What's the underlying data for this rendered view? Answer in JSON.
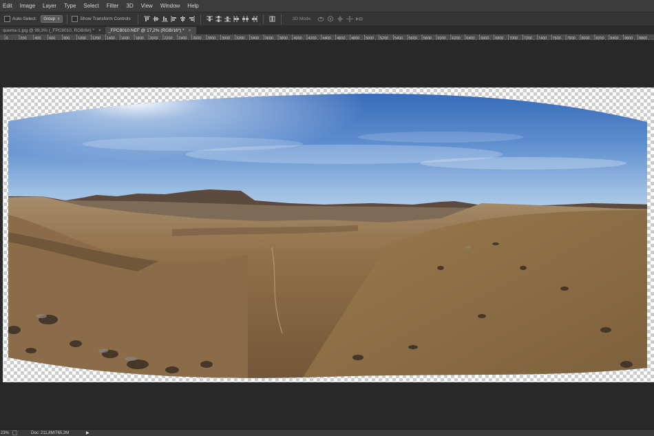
{
  "menu": [
    "Edit",
    "Image",
    "Layer",
    "Type",
    "Select",
    "Filter",
    "3D",
    "View",
    "Window",
    "Help"
  ],
  "options": {
    "auto_select_label": "Auto-Select:",
    "auto_select_value": "Group",
    "show_transform_label": "Show Transform Controls",
    "mode_3d_label": "3D Mode:"
  },
  "tabs": [
    {
      "label": "quema-1.jpg @ 99,3% (_FPC8010, RGB/8#) *",
      "close": "×",
      "active": false
    },
    {
      "label": "_FPC8010.NEF @ 17,2% (RGB/16*) *",
      "close": "×",
      "active": true
    }
  ],
  "ruler": {
    "origin_label": "0",
    "ticks": [
      "200",
      "400",
      "600",
      "800",
      "1000",
      "1200",
      "1400",
      "1600",
      "1800",
      "2000",
      "2200",
      "2400",
      "2600",
      "2800",
      "3000",
      "3200",
      "3400",
      "3600",
      "3800",
      "4000",
      "4200",
      "4400",
      "4600",
      "4800",
      "5000",
      "5200",
      "5400",
      "5600",
      "5800",
      "6000",
      "6200",
      "6400",
      "6600",
      "6800",
      "7000",
      "7200",
      "7400",
      "7600",
      "7800",
      "8000",
      "8200",
      "8400",
      "8600",
      "8800"
    ]
  },
  "status": {
    "zoom": "23%",
    "doc": "Doc: 211,8M/765,3M",
    "menu_arrow": "▶"
  },
  "colors": {
    "app_bg": "#282828",
    "menubar": "#3c3c3c",
    "sky_top": "#2f63b4",
    "sky_horizon": "#bcd3ea",
    "ground": "#8f7048"
  }
}
